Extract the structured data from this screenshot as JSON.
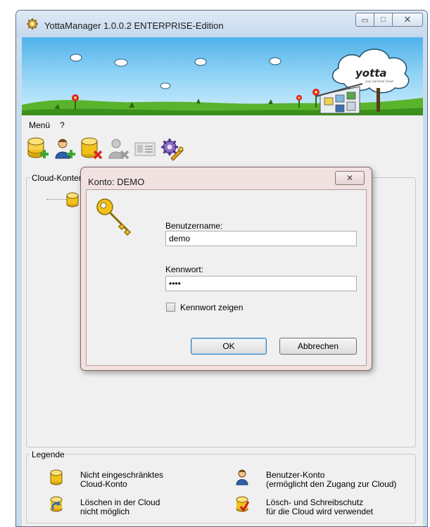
{
  "window": {
    "title": "YottaManager 1.0.0.2  ENTERPRISE-Edition",
    "controls": {
      "minimize": "▭",
      "maximize": "□",
      "close": "✕"
    }
  },
  "banner": {
    "logo_text": "yotta",
    "logo_tagline": "your personal cloud"
  },
  "menu": {
    "items": [
      "Menü",
      "?"
    ]
  },
  "toolbar": {
    "buttons": [
      {
        "icon": "add-cloud-icon",
        "enabled": true
      },
      {
        "icon": "add-user-icon",
        "enabled": true
      },
      {
        "icon": "delete-cloud-icon",
        "enabled": true
      },
      {
        "icon": "delete-user-icon",
        "enabled": false
      },
      {
        "icon": "properties-card-icon",
        "enabled": false
      },
      {
        "icon": "settings-gears-icon",
        "enabled": true
      }
    ]
  },
  "cloud_group": {
    "title": "Cloud-Konten"
  },
  "legend": {
    "title": "Legende",
    "items": [
      {
        "icon": "cloud-account-icon",
        "text": "Nicht eingeschränktes\nCloud-Konto"
      },
      {
        "icon": "user-account-icon",
        "text": "Benutzer-Konto\n(ermöglicht den Zugang zur Cloud)"
      },
      {
        "icon": "no-delete-icon",
        "text": "Löschen in der Cloud\nnicht möglich"
      },
      {
        "icon": "write-protect-icon",
        "text": "Lösch- und Schreibschutz\nfür die Cloud wird verwendet"
      }
    ]
  },
  "dialog": {
    "title": "Konto: DEMO",
    "close": "✕",
    "username_label": "Benutzername:",
    "username_value": "demo",
    "password_label": "Kennwort:",
    "password_value": "demo",
    "show_password_label": "Kennwort zeigen",
    "show_password_checked": false,
    "ok_label": "OK",
    "cancel_label": "Abbrechen"
  },
  "colors": {
    "sky": "#6ec3ef",
    "grass": "#59b32c",
    "coin_gold": "#f2c21b",
    "dialog_frame": "#f2e1e1"
  }
}
